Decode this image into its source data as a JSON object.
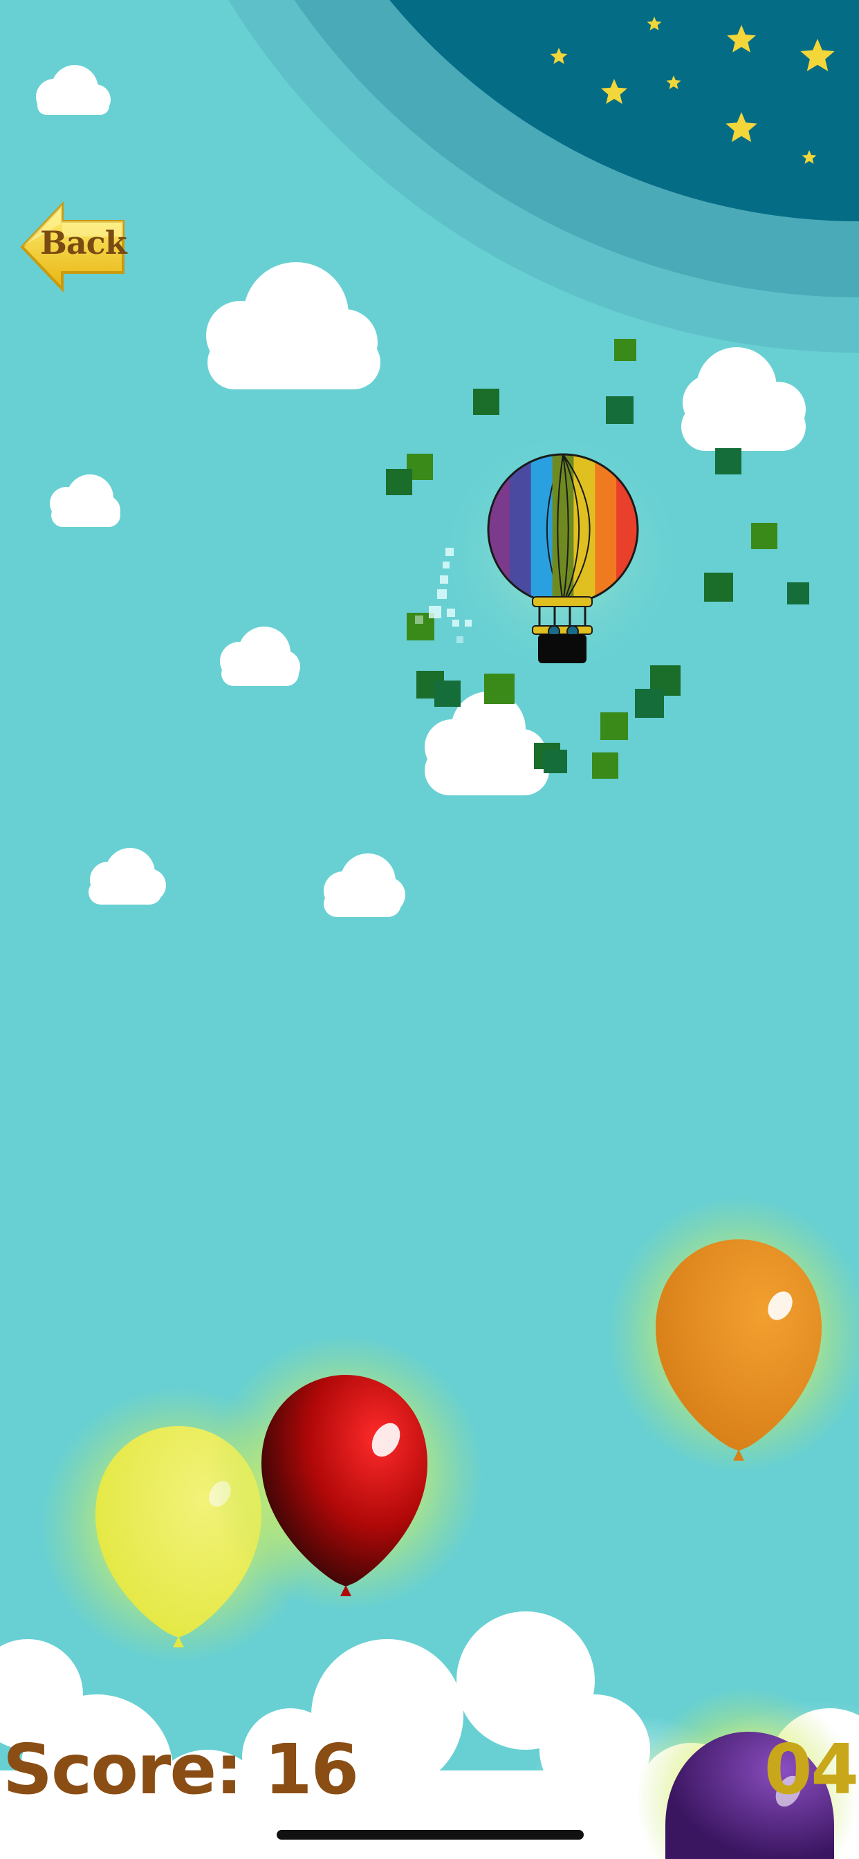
{
  "back_button": {
    "label": "Back",
    "icon": "arrow-left-icon"
  },
  "hud": {
    "score_text": "Score: 16",
    "right_text": "04"
  },
  "hot_air_balloon": {
    "stripes": [
      "#7b3a8c",
      "#4a4aa0",
      "#2aa0e0",
      "#6e8a20",
      "#e0c020",
      "#f07a20",
      "#e8402a"
    ]
  },
  "balloons": [
    {
      "name": "orange-balloon",
      "color": "#e8921f"
    },
    {
      "name": "red-balloon",
      "color": "#d10b0b"
    },
    {
      "name": "yellow-balloon",
      "color": "#e8ec50"
    },
    {
      "name": "purple-balloon",
      "color": "#5a2a8a"
    }
  ],
  "colors": {
    "sky": "#68d0d3",
    "night": "#056c86",
    "star": "#f2d63a",
    "particle": "#1a7a1a"
  }
}
